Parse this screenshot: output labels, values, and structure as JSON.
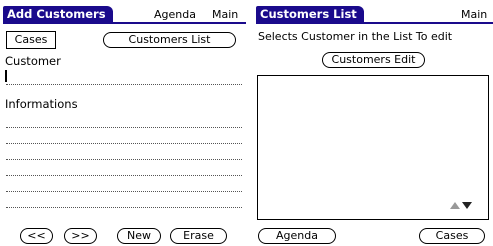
{
  "left_screen": {
    "title": "Add Customers",
    "menu": {
      "agenda": "Agenda",
      "main": "Main"
    },
    "cases_button": "Cases",
    "customers_list_button": "Customers List",
    "customer_label": "Customer",
    "informations_label": "Informations",
    "buttons": {
      "prev": "<<",
      "next": ">>",
      "new": "New",
      "erase": "Erase"
    }
  },
  "right_screen": {
    "title": "Customers List",
    "menu": {
      "main": "Main"
    },
    "instruction": "Selects Customer in the List To edit",
    "customers_edit_button": "Customers Edit",
    "list_items": [],
    "buttons": {
      "agenda": "Agenda",
      "cases": "Cases"
    }
  },
  "colors": {
    "title_bar": "#1a0a8c"
  }
}
